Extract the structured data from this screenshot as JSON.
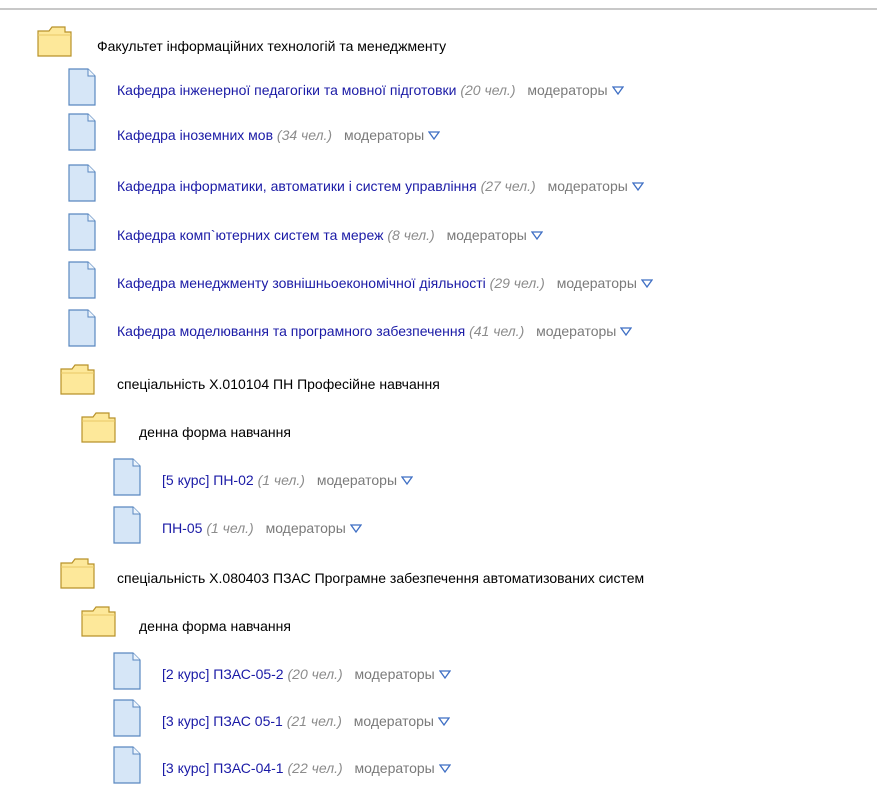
{
  "colors": {
    "link": "#1a1aa6",
    "count": "#8c8c8c",
    "moderators": "#7a7a7a",
    "folder_fill": "#fde89a",
    "folder_stroke": "#b8922a",
    "doc_fill": "#d6e6f7",
    "doc_stroke": "#5a88c0"
  },
  "tree": {
    "faculty": {
      "icon": "folder-icon",
      "label": "Факультет інформаційних технологій та менеджменту"
    },
    "departments": [
      {
        "icon": "document-icon",
        "name": "Кафедра інженерної педагогіки та мовної підготовки",
        "count": "(20 чел.)",
        "moderators": "модераторы"
      },
      {
        "icon": "document-icon",
        "name": "Кафедра іноземних мов",
        "count": "(34 чел.)",
        "moderators": "модераторы"
      },
      {
        "icon": "document-icon",
        "name": "Кафедра інформатики, автоматики і систем управління",
        "count": "(27 чел.)",
        "moderators": "модераторы"
      },
      {
        "icon": "document-icon",
        "name": "Кафедра комп`ютерних систем та мереж",
        "count": "(8 чел.)",
        "moderators": "модераторы"
      },
      {
        "icon": "document-icon",
        "name": "Кафедра менеджменту зовнішньоекономічної діяльності",
        "count": "(29 чел.)",
        "moderators": "модераторы"
      },
      {
        "icon": "document-icon",
        "name": "Кафедра моделювання та програмного забезпечення",
        "count": "(41 чел.)",
        "moderators": "модераторы"
      }
    ],
    "specialties": [
      {
        "icon": "folder-icon",
        "label": "спеціальність Х.010104 ПН Професійне навчання",
        "form": {
          "icon": "folder-icon",
          "label": "денна форма навчання"
        },
        "groups": [
          {
            "icon": "document-icon",
            "name": "[5 курс] ПН-02",
            "count": "(1 чел.)",
            "moderators": "модераторы"
          },
          {
            "icon": "document-icon",
            "name": "ПН-05",
            "count": "(1 чел.)",
            "moderators": "модераторы"
          }
        ]
      },
      {
        "icon": "folder-icon",
        "label": "спеціальність Х.080403 ПЗАС Програмне забезпечення автоматизованих систем",
        "form": {
          "icon": "folder-icon",
          "label": "денна форма навчання"
        },
        "groups": [
          {
            "icon": "document-icon",
            "name": "[2 курс] ПЗАС-05-2",
            "count": "(20 чел.)",
            "moderators": "модераторы"
          },
          {
            "icon": "document-icon",
            "name": "[3 курс] ПЗАС 05-1",
            "count": "(21 чел.)",
            "moderators": "модераторы"
          },
          {
            "icon": "document-icon",
            "name": "[3 курс] ПЗАС-04-1",
            "count": "(22 чел.)",
            "moderators": "модераторы"
          }
        ]
      }
    ]
  }
}
